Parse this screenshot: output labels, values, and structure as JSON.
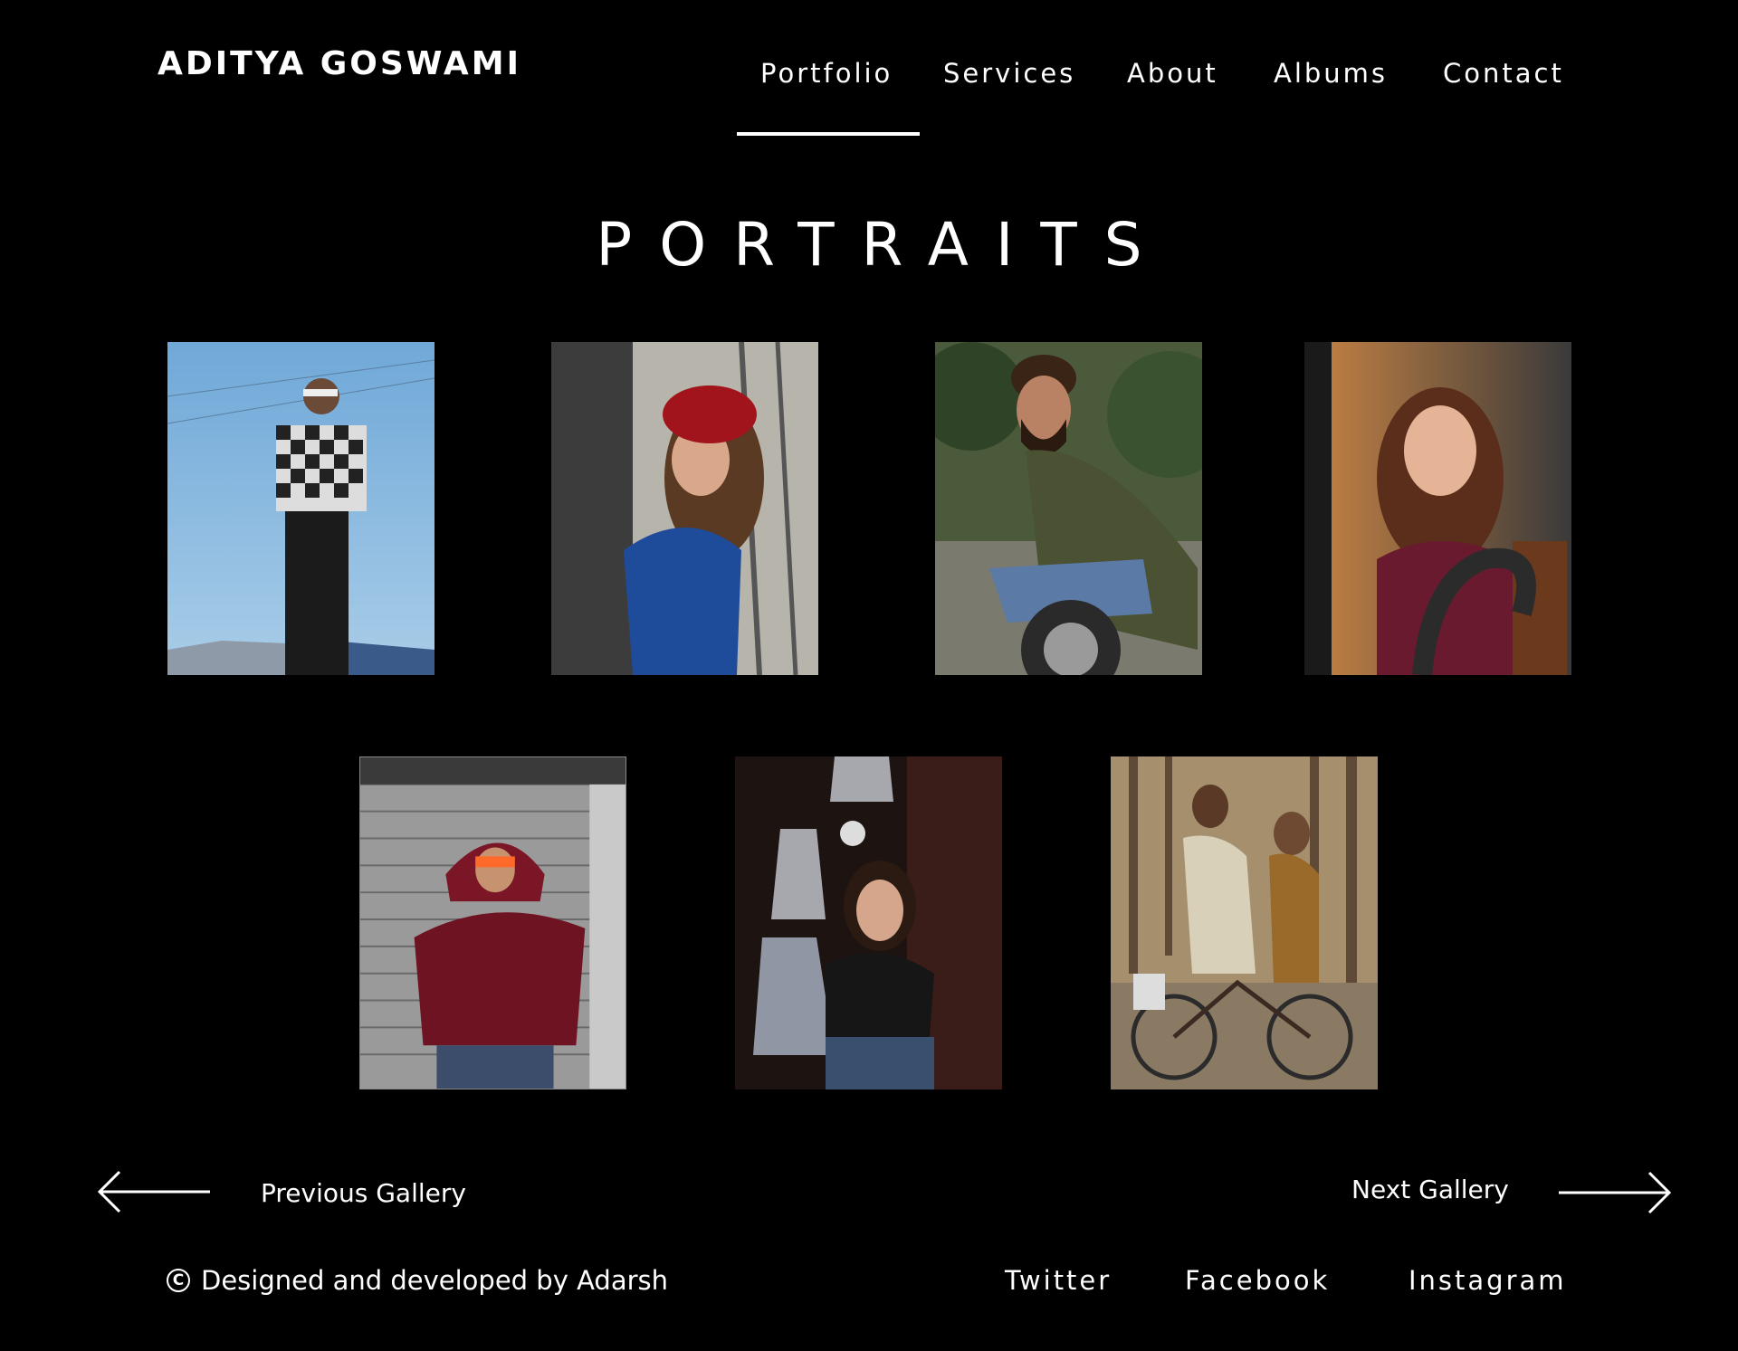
{
  "header": {
    "brand": "ADITYA GOSWAMI",
    "nav": [
      {
        "label": "Portfolio",
        "active": true
      },
      {
        "label": "Services"
      },
      {
        "label": "About"
      },
      {
        "label": "Albums"
      },
      {
        "label": "Contact"
      }
    ]
  },
  "main": {
    "title": "PORTRAITS",
    "photos": [
      {
        "subject": "man in checkered shirt with sunglasses against blue sky"
      },
      {
        "subject": "woman in red beret and blue coat by tree"
      },
      {
        "subject": "bearded man in olive shirt sitting on wheel"
      },
      {
        "subject": "smiling woman with wavy hair holding chain"
      },
      {
        "subject": "man in maroon hoodie and orange glasses against shutter"
      },
      {
        "subject": "woman with glasses beside hanging lamps"
      },
      {
        "subject": "elderly couple riding a bicycle"
      }
    ]
  },
  "pager": {
    "previous_label": "Previous Gallery",
    "next_label": "Next Gallery"
  },
  "footer": {
    "copyright_symbol": "C",
    "credit": "Designed and developed by Adarsh",
    "social": [
      "Twitter",
      "Facebook",
      "Instagram"
    ]
  },
  "colors": {
    "background": "#000000",
    "text": "#ffffff"
  }
}
